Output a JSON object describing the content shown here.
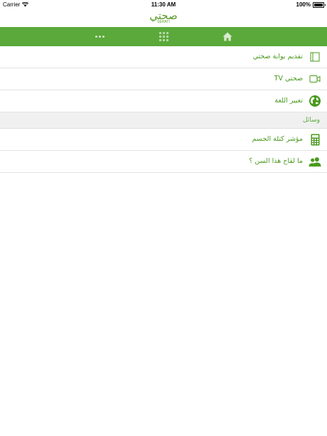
{
  "status_bar": {
    "carrier": "Carrier",
    "time": "11:30 AM",
    "battery": "100%"
  },
  "header": {
    "logo_text": "صحتي",
    "logo_subtitle": "SEHATI"
  },
  "colors": {
    "accent": "#5aa93a",
    "label_green": "#4a9a1f",
    "section_bg": "#f0f0f0",
    "divider": "#e3e3e3"
  },
  "nav": {
    "items": [
      {
        "icon": "more-dots-icon"
      },
      {
        "icon": "grid-menu-icon"
      },
      {
        "icon": "home-icon"
      }
    ]
  },
  "menu": {
    "items": [
      {
        "label": "تقديم بوابة صحتي",
        "icon": "book-icon"
      },
      {
        "label": "صحتي TV",
        "icon": "video-camera-icon"
      },
      {
        "label": "تغيير اللغة",
        "icon": "globe-icon"
      }
    ],
    "section_title": "وسائل",
    "tools": [
      {
        "label": "مؤشر كتلة الجسم",
        "icon": "calculator-icon"
      },
      {
        "label": "ما لقاح هذا السن ؟",
        "icon": "people-icon"
      }
    ]
  }
}
